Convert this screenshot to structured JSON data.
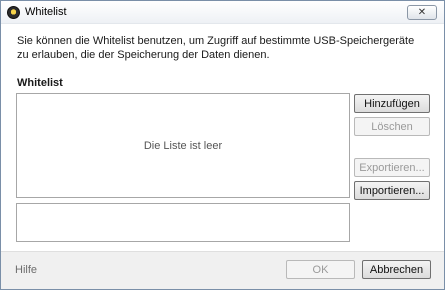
{
  "window": {
    "title": "Whitelist",
    "close_label": "✕"
  },
  "intro": {
    "text": "Sie können die Whitelist benutzen, um Zugriff auf bestimmte USB-Speichergeräte zu erlauben, die der Speicherung der Daten dienen."
  },
  "whitelist": {
    "heading": "Whitelist",
    "empty_text": "Die Liste ist leer"
  },
  "buttons": {
    "add": "Hinzufügen",
    "delete": "Löschen",
    "export": "Exportieren...",
    "import": "Importieren..."
  },
  "footer": {
    "help": "Hilfe",
    "ok": "OK",
    "cancel": "Abbrechen"
  },
  "colors": {
    "window_border": "#7a8fa8",
    "footer_bg": "#f0f0f0",
    "disabled_text": "#9a9a9a"
  }
}
